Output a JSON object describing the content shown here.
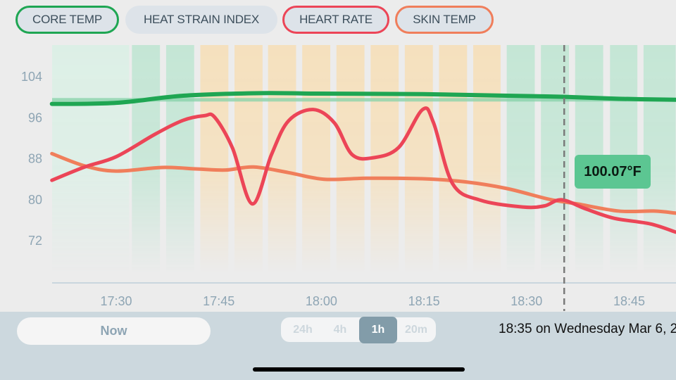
{
  "metric_chips": [
    {
      "label": "CORE TEMP",
      "color": "#1fa653"
    },
    {
      "label": "HEAT STRAIN INDEX",
      "color": null
    },
    {
      "label": "HEART RATE",
      "color": "#ec4557"
    },
    {
      "label": "SKIN TEMP",
      "color": "#f07e5b"
    }
  ],
  "tooltip": {
    "value": "100.07°F",
    "color": "#5cc692"
  },
  "controls": {
    "now_label": "Now",
    "range_options": [
      "24h",
      "4h",
      "1h",
      "20m"
    ],
    "range_selected": "1h",
    "datetime_label": "18:35 on Wednesday Mar 6, 2"
  },
  "chart_data": {
    "type": "line",
    "title": "",
    "xlabel": "",
    "ylabel": "",
    "x_unit": "minutes since 17:00",
    "xlim": [
      20.6,
      111.8
    ],
    "ylim": [
      68,
      108
    ],
    "y_ticks": [
      104,
      96,
      88,
      80,
      72
    ],
    "x_ticks": [
      {
        "label": "17:30",
        "value": 30
      },
      {
        "label": "17:45",
        "value": 45
      },
      {
        "label": "18:00",
        "value": 60
      },
      {
        "label": "18:15",
        "value": 75
      },
      {
        "label": "18:30",
        "value": 90
      },
      {
        "label": "18:45",
        "value": 105
      }
    ],
    "cursor": {
      "time": "18:35",
      "value": 95.5
    },
    "reference_band": {
      "value": 99.5,
      "color": "#86d2a8"
    },
    "zones": [
      {
        "start": 20.6,
        "end": 31.9,
        "level": "light-green"
      },
      {
        "start": 32.3,
        "end": 36.4,
        "level": "green"
      },
      {
        "start": 37.3,
        "end": 41.4,
        "level": "green"
      },
      {
        "start": 42.3,
        "end": 46.4,
        "level": "orange"
      },
      {
        "start": 47.3,
        "end": 51.4,
        "level": "orange"
      },
      {
        "start": 52.2,
        "end": 56.3,
        "level": "orange"
      },
      {
        "start": 57.2,
        "end": 61.3,
        "level": "orange"
      },
      {
        "start": 62.2,
        "end": 66.3,
        "level": "orange"
      },
      {
        "start": 67.2,
        "end": 71.3,
        "level": "orange"
      },
      {
        "start": 72.2,
        "end": 76.3,
        "level": "orange"
      },
      {
        "start": 77.2,
        "end": 81.3,
        "level": "orange"
      },
      {
        "start": 82.2,
        "end": 86.2,
        "level": "orange"
      },
      {
        "start": 87.1,
        "end": 91.2,
        "level": "green"
      },
      {
        "start": 92.1,
        "end": 96.2,
        "level": "green"
      },
      {
        "start": 97.1,
        "end": 101.2,
        "level": "green"
      },
      {
        "start": 102.2,
        "end": 106.2,
        "level": "green"
      },
      {
        "start": 107.1,
        "end": 111.8,
        "level": "green"
      }
    ],
    "zone_colors": {
      "light-green": "#dcefe6",
      "green": "#c4e6d5",
      "orange": "#f5e0bd"
    },
    "series": [
      {
        "name": "Core Temp",
        "color": "#1fa653",
        "x": [
          20.6,
          30,
          39.8,
          51.1,
          59.3,
          74.8,
          87.1,
          95.6,
          103.5,
          111.8
        ],
        "y": [
          98.7,
          98.9,
          100.3,
          100.8,
          100.7,
          100.6,
          100.3,
          100.07,
          99.7,
          99.5
        ]
      },
      {
        "name": "Heart Rate",
        "color": "#ec4557",
        "x": [
          20.6,
          25.4,
          30,
          35.7,
          39.8,
          42.9,
          44.4,
          47,
          49.9,
          52.7,
          55.2,
          58.8,
          61.9,
          64.5,
          67.6,
          71.3,
          74.8,
          76.4,
          79.2,
          83.3,
          89.4,
          92.6,
          95.1,
          98.7,
          102.8,
          108.1,
          111.8
        ],
        "y": [
          83.8,
          86.4,
          88.4,
          92.8,
          95.5,
          96.4,
          96.1,
          90.1,
          79.2,
          88.8,
          95.4,
          97.6,
          95.0,
          88.8,
          88.2,
          90.2,
          97.6,
          95.0,
          83.1,
          79.9,
          78.6,
          78.8,
          80.0,
          78.2,
          76.4,
          75.3,
          73.7
        ]
      },
      {
        "name": "Skin Temp",
        "color": "#f07e5b",
        "x": [
          20.6,
          25.4,
          30,
          36.7,
          41.9,
          46,
          50.1,
          55.2,
          60.4,
          66.6,
          74.8,
          81,
          87.1,
          93.3,
          97.4,
          103.5,
          108.6,
          111.8
        ],
        "y": [
          89.0,
          86.6,
          85.6,
          86.3,
          86.0,
          85.8,
          86.4,
          85.3,
          84.0,
          84.2,
          84.1,
          83.5,
          82.2,
          80.1,
          79.2,
          77.8,
          77.8,
          77.4
        ]
      }
    ]
  }
}
